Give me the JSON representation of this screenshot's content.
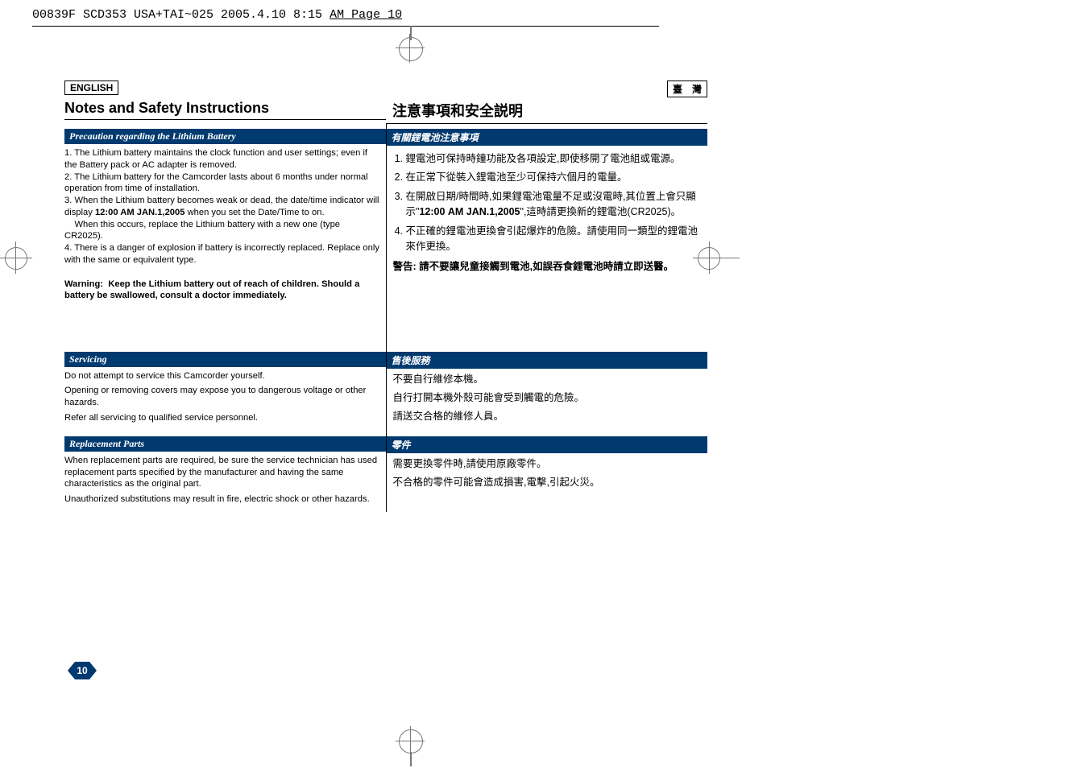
{
  "header_line_prefix": "00839F SCD353 USA+TAI~025  2005.4.10 8:15 ",
  "header_line_ampage": "AM  Page ",
  "header_line_pageno": "10",
  "left": {
    "lang_tag": "ENGLISH",
    "doc_title": "Notes and Safety Instructions",
    "sec1_title": "Precaution regarding the Lithium Battery",
    "sec1_items": [
      "The Lithium battery maintains the clock function and user settings; even if the Battery pack or AC adapter is removed.",
      "The Lithium battery for the Camcorder lasts about 6 months under normal operation from time of installation.",
      "When the Lithium battery becomes weak or dead, the date/time indicator will display 12:00 AM JAN.1,2005 when you set the Date/Time to on.\nWhen this occurs, replace the Lithium battery with a new one (type CR2025).",
      "There is a danger of explosion if battery is incorrectly replaced. Replace only with the same or equivalent type."
    ],
    "sec1_item3_pre": "When the Lithium battery becomes weak or dead, the date/time indicator will display ",
    "sec1_item3_bold": "12:00 AM JAN.1,2005",
    "sec1_item3_post": " when you set the Date/Time to on.",
    "sec1_item3_line2": "When this occurs, replace the Lithium battery with a new one (type CR2025).",
    "warning_label": "Warning:",
    "warning_text": "Keep the Lithium battery out of reach of children. Should a battery be swallowed, consult a doctor immediately.",
    "sec2_title": "Servicing",
    "sec2_lines": [
      "Do not attempt to service this Camcorder yourself.",
      "Opening or removing covers may expose you to dangerous voltage or other hazards.",
      "Refer all servicing to qualified service personnel."
    ],
    "sec3_title": "Replacement Parts",
    "sec3_lines": [
      "When replacement parts are required, be sure the service technician has used replacement parts specified by the manufacturer and having the same characteristics as the original part.",
      "Unauthorized substitutions may result in fire, electric shock or other hazards."
    ]
  },
  "right": {
    "lang_tag": "臺　灣",
    "doc_title": "注意事項和安全説明",
    "sec1_title": "有關鋰電池注意事項",
    "sec1_items": [
      "鋰電池可保持時鐘功能及各項設定,即使移開了電池組或電源。",
      "在正常下從裝入鋰電池至少可保持六個月的電量。",
      "在開啟日期/時間時,如果鋰電池電量不足或沒電時,其位置上會只顯示\"12:00 AM JAN.1,2005\",這時請更換新的鋰電池(CR2025)。",
      "不正確的鋰電池更換會引起爆炸的危險。請使用同一類型的鋰電池來作更換。"
    ],
    "sec1_item3_pre": "在開啟日期/時間時,如果鋰電池電量不足或沒電時,其位置上會只顯示\"",
    "sec1_item3_bold": "12:00 AM JAN.1,2005",
    "sec1_item3_post": "\",這時請更換新的鋰電池(CR2025)。",
    "warning_full": "警告: 請不要讓兒童接觸到電池,如誤吞食鋰電池時請立即送醫。",
    "sec2_title": "售後服務",
    "sec2_lines": [
      "不要自行維修本機。",
      "自行打開本機外殼可能會受到觸電的危險。",
      "請送交合格的維修人員。"
    ],
    "sec3_title": "零件",
    "sec3_lines": [
      "需要更換零件時,請使用原廠零件。",
      "不合格的零件可能會造成損害,電擊,引起火災。"
    ]
  },
  "page_number": "10"
}
